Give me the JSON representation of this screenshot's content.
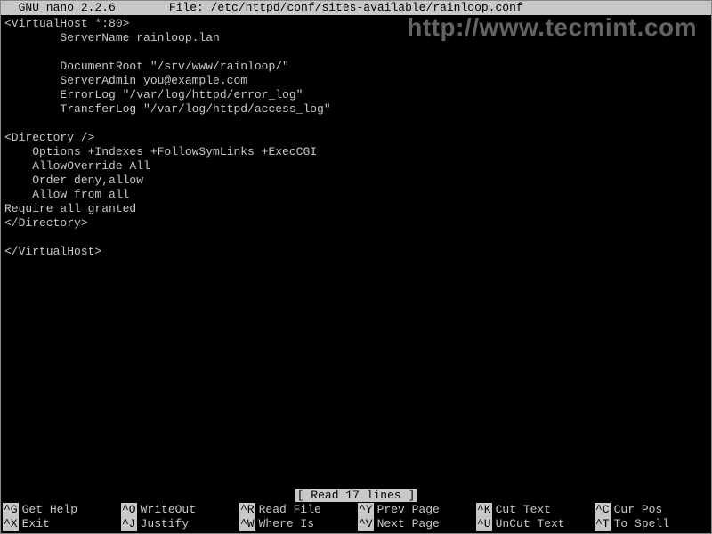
{
  "title": {
    "app": "  GNU nano 2.2.6",
    "file": "File: /etc/httpd/conf/sites-available/rainloop.conf"
  },
  "watermark": "http://www.tecmint.com",
  "file_content": "<VirtualHost *:80>\n        ServerName rainloop.lan\n\n        DocumentRoot \"/srv/www/rainloop/\"\n        ServerAdmin you@example.com\n        ErrorLog \"/var/log/httpd/error_log\"\n        TransferLog \"/var/log/httpd/access_log\"\n\n<Directory />\n    Options +Indexes +FollowSymLinks +ExecCGI\n    AllowOverride All\n    Order deny,allow\n    Allow from all\nRequire all granted\n</Directory>\n\n</VirtualHost>",
  "status": "[ Read 17 lines ]",
  "shortcuts": [
    {
      "key": "^G",
      "label": "Get Help"
    },
    {
      "key": "^O",
      "label": "WriteOut"
    },
    {
      "key": "^R",
      "label": "Read File"
    },
    {
      "key": "^Y",
      "label": "Prev Page"
    },
    {
      "key": "^K",
      "label": "Cut Text"
    },
    {
      "key": "^C",
      "label": "Cur Pos"
    },
    {
      "key": "^X",
      "label": "Exit"
    },
    {
      "key": "^J",
      "label": "Justify"
    },
    {
      "key": "^W",
      "label": "Where Is"
    },
    {
      "key": "^V",
      "label": "Next Page"
    },
    {
      "key": "^U",
      "label": "UnCut Text"
    },
    {
      "key": "^T",
      "label": "To Spell"
    }
  ]
}
